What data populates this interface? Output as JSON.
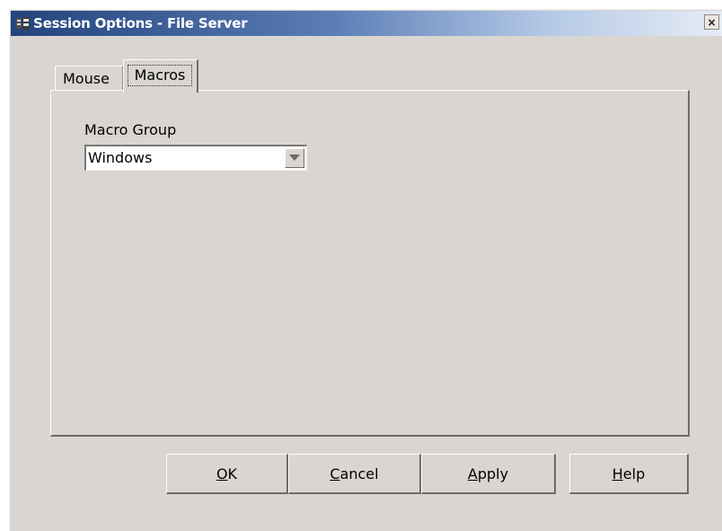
{
  "window": {
    "title": "Session Options - File Server",
    "close_glyph": "×",
    "app_icon": "app-window-icon"
  },
  "tabs": [
    {
      "label": "Mouse",
      "active": false
    },
    {
      "label": "Macros",
      "active": true
    }
  ],
  "macros": {
    "group_label": "Macro Group",
    "selected_group": "Windows",
    "dropdown_icon": "chevron-down-icon"
  },
  "buttons": {
    "ok": {
      "mnemonic": "O",
      "rest": "K"
    },
    "cancel": {
      "mnemonic": "C",
      "rest": "ancel"
    },
    "apply": {
      "mnemonic": "A",
      "rest": "pply"
    },
    "help": {
      "mnemonic": "H",
      "rest": "elp"
    }
  },
  "colors": {
    "title_bar_start": "#23437d",
    "title_bar_end": "#e6ecf5",
    "dialog_face": "#d9d5d0"
  }
}
